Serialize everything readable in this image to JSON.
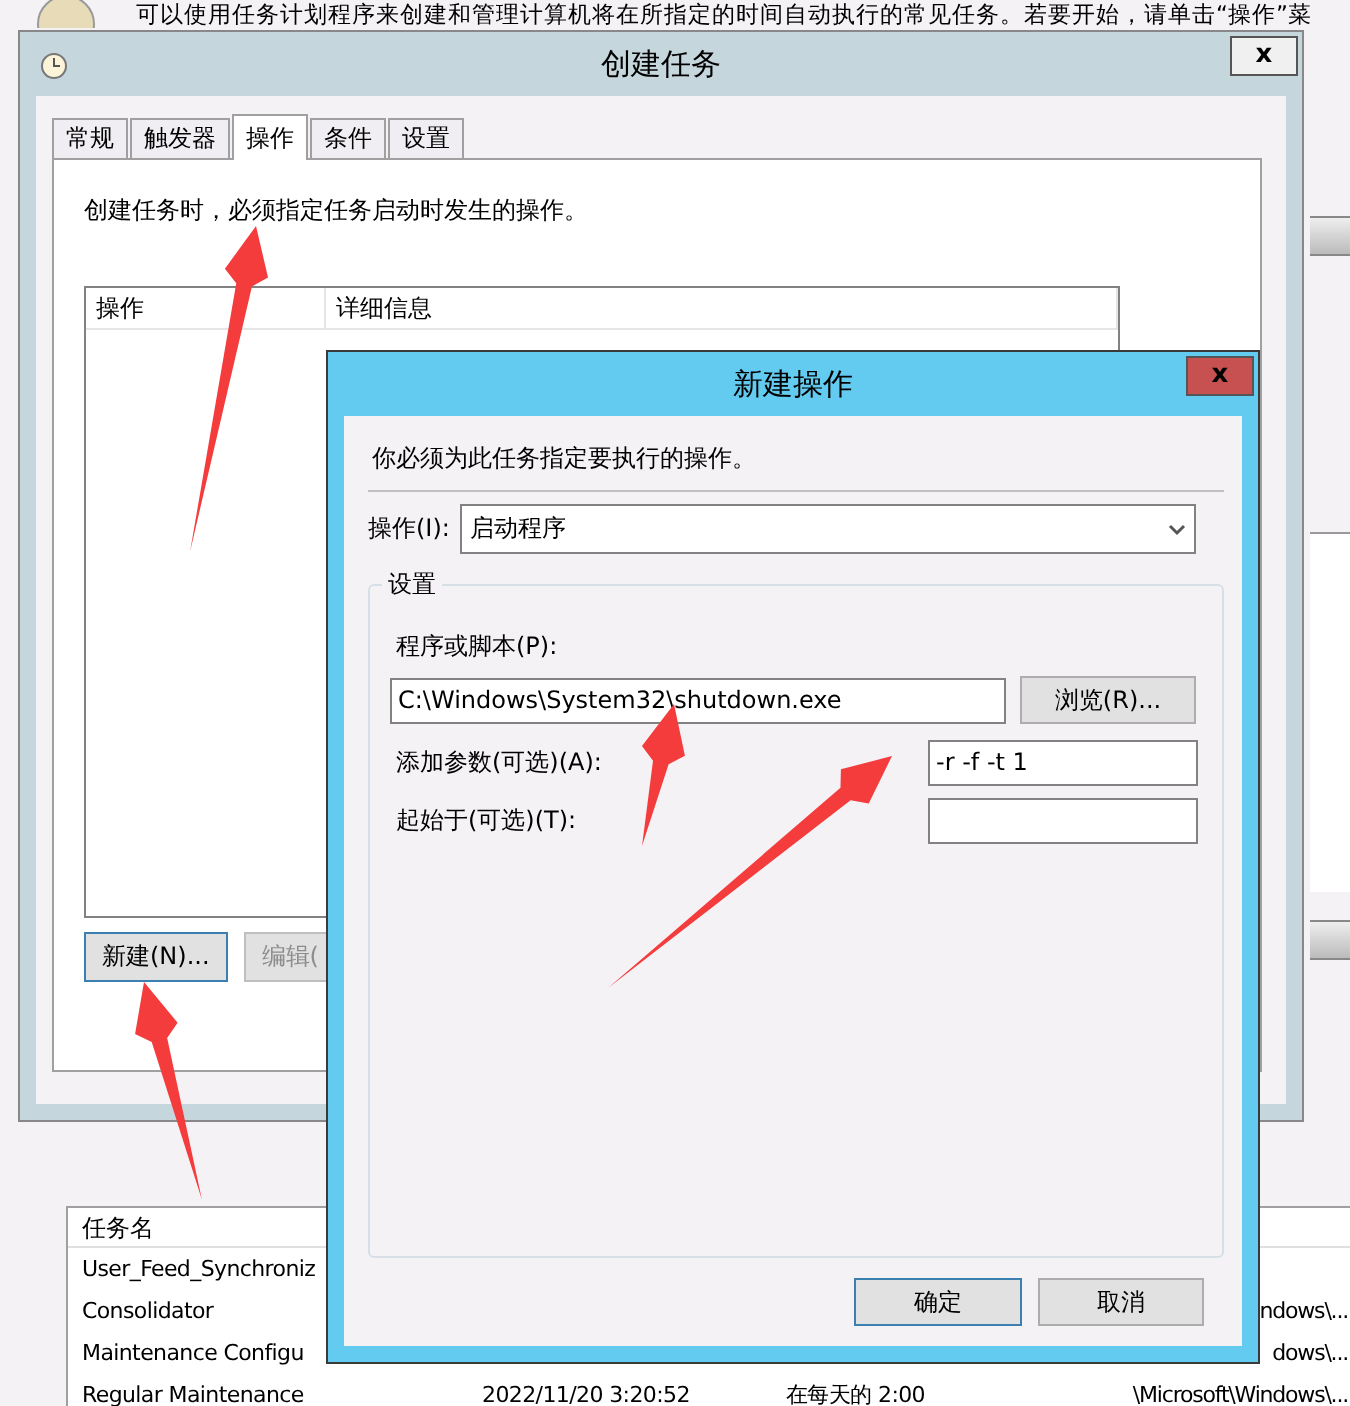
{
  "background": {
    "intro": "可以使用任务计划程序来创建和管理计算机将在所指定的时间自动执行的常见任务。若要开始，请单击“操作”菜",
    "task_table": {
      "columns": [
        "任务名"
      ],
      "rows": [
        {
          "name": "User_Feed_Synchroniz"
        },
        {
          "name": "Consolidator",
          "path": "ndows\\..."
        },
        {
          "name": "Maintenance Configu",
          "path": "dows\\..."
        },
        {
          "name": "Regular Maintenance",
          "time": "2022/11/20 3:20:52",
          "trigger": "在每天的 2:00",
          "path": "\\Microsoft\\Windows\\..."
        }
      ]
    }
  },
  "create_task_window": {
    "title": "创建任务",
    "close": "x",
    "tabs": [
      {
        "label": "常规",
        "selected": false
      },
      {
        "label": "触发器",
        "selected": false
      },
      {
        "label": "操作",
        "selected": true
      },
      {
        "label": "条件",
        "selected": false
      },
      {
        "label": "设置",
        "selected": false
      }
    ],
    "description": "创建任务时，必须指定任务启动时发生的操作。",
    "list_columns": [
      "操作",
      "详细信息"
    ],
    "buttons": [
      {
        "label": "新建(N)...",
        "disabled": false
      },
      {
        "label": "编辑(",
        "disabled": true
      }
    ]
  },
  "new_action_dialog": {
    "title": "新建操作",
    "close": "x",
    "instruction": "你必须为此任务指定要执行的操作。",
    "action_label": "操作(I):",
    "action_value": "启动程序",
    "group_title": "设置",
    "program_label": "程序或脚本(P):",
    "program_value": "C:\\Windows\\System32\\shutdown.exe",
    "browse": "浏览(R)...",
    "args_label": "添加参数(可选)(A):",
    "args_value": "-r -f -t 1",
    "start_label": "起始于(可选)(T):",
    "ok": "确定",
    "cancel": "取消"
  },
  "annotations": [
    {
      "kind": "arrow"
    },
    {
      "kind": "arrow"
    },
    {
      "kind": "arrow"
    },
    {
      "kind": "arrow"
    }
  ]
}
